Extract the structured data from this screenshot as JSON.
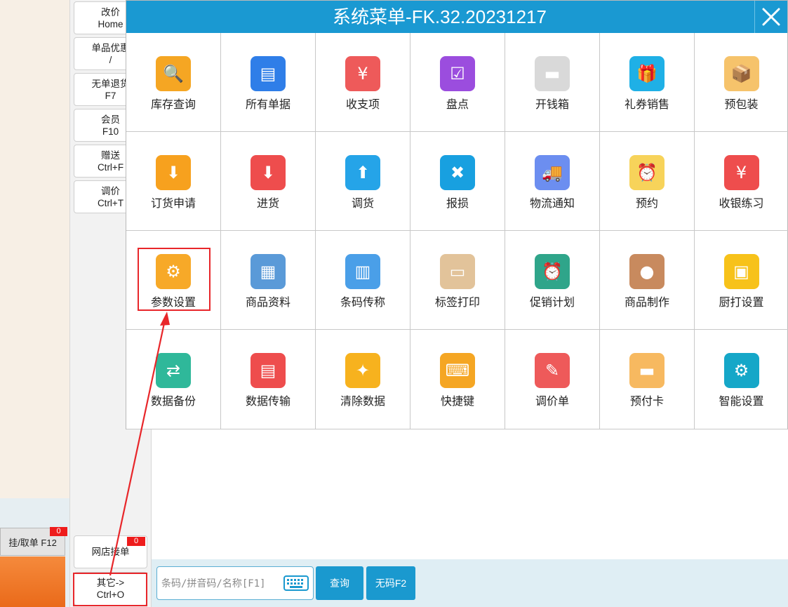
{
  "menu": {
    "title": "系统菜单-FK.32.20231217",
    "items": [
      {
        "label": "库存查询",
        "icon": "inventory-query-icon",
        "color": "#f5a623"
      },
      {
        "label": "所有单据",
        "icon": "all-documents-icon",
        "color": "#2f7ee8"
      },
      {
        "label": "收支项",
        "icon": "income-expense-icon",
        "color": "#ee5a5a"
      },
      {
        "label": "盘点",
        "icon": "stocktake-icon",
        "color": "#9b4dde"
      },
      {
        "label": "开钱箱",
        "icon": "cash-drawer-icon",
        "color": "#d9d9d9"
      },
      {
        "label": "礼券销售",
        "icon": "gift-voucher-icon",
        "color": "#1fb0e6"
      },
      {
        "label": "预包装",
        "icon": "prepackage-icon",
        "color": "#f6c36b"
      },
      {
        "label": "订货申请",
        "icon": "order-request-icon",
        "color": "#f7a11e"
      },
      {
        "label": "进货",
        "icon": "purchase-icon",
        "color": "#ee4d4d"
      },
      {
        "label": "调货",
        "icon": "transfer-icon",
        "color": "#25a4e8"
      },
      {
        "label": "报损",
        "icon": "damage-report-icon",
        "color": "#18a0e0"
      },
      {
        "label": "物流通知",
        "icon": "logistics-notice-icon",
        "color": "#6c8ef0"
      },
      {
        "label": "预约",
        "icon": "appointment-icon",
        "color": "#f7d35a"
      },
      {
        "label": "收银练习",
        "icon": "cashier-practice-icon",
        "color": "#ee4d4d"
      },
      {
        "label": "参数设置",
        "icon": "parameter-settings-icon",
        "color": "#f7a928"
      },
      {
        "label": "商品资料",
        "icon": "product-info-icon",
        "color": "#5a9ad8"
      },
      {
        "label": "条码传称",
        "icon": "barcode-scale-icon",
        "color": "#4a9fe8"
      },
      {
        "label": "标签打印",
        "icon": "label-print-icon",
        "color": "#e2c39a"
      },
      {
        "label": "促销计划",
        "icon": "promotion-plan-icon",
        "color": "#2fa58a"
      },
      {
        "label": "商品制作",
        "icon": "product-making-icon",
        "color": "#c88a5e"
      },
      {
        "label": "厨打设置",
        "icon": "kitchen-print-icon",
        "color": "#f7c21a"
      },
      {
        "label": "数据备份",
        "icon": "data-backup-icon",
        "color": "#2fb89a"
      },
      {
        "label": "数据传输",
        "icon": "data-transfer-icon",
        "color": "#ee4d4d"
      },
      {
        "label": "清除数据",
        "icon": "clear-data-icon",
        "color": "#f7b21e"
      },
      {
        "label": "快捷键",
        "icon": "shortcut-keys-icon",
        "color": "#f5a623"
      },
      {
        "label": "调价单",
        "icon": "price-adjust-sheet-icon",
        "color": "#ee5a5a"
      },
      {
        "label": "预付卡",
        "icon": "prepaid-card-icon",
        "color": "#f7b960"
      },
      {
        "label": "智能设置",
        "icon": "smart-settings-icon",
        "color": "#15a7c8"
      }
    ]
  },
  "func_buttons": [
    {
      "line1": "改价",
      "line2": "Home"
    },
    {
      "line1": "单品优惠",
      "line2": "/"
    },
    {
      "line1": "无单退货",
      "line2": "F7"
    },
    {
      "line1": "会员",
      "line2": "F10"
    },
    {
      "line1": "赠送",
      "line2": "Ctrl+F"
    },
    {
      "line1": "调价",
      "line2": "Ctrl+T"
    }
  ],
  "online_order": {
    "label": "网店接单",
    "badge": "0"
  },
  "other": {
    "line1": "其它->",
    "line2": "Ctrl+O"
  },
  "hold": {
    "label": "挂/取单 F12",
    "badge": "0"
  },
  "search": {
    "placeholder": "条码/拼音码/名称[F1]"
  },
  "query_button": "查询",
  "no_code_button": "无码F2",
  "colors": {
    "header": "#1a99d2",
    "annotation": "#e8262a",
    "accent_button": "#1a99cf"
  }
}
